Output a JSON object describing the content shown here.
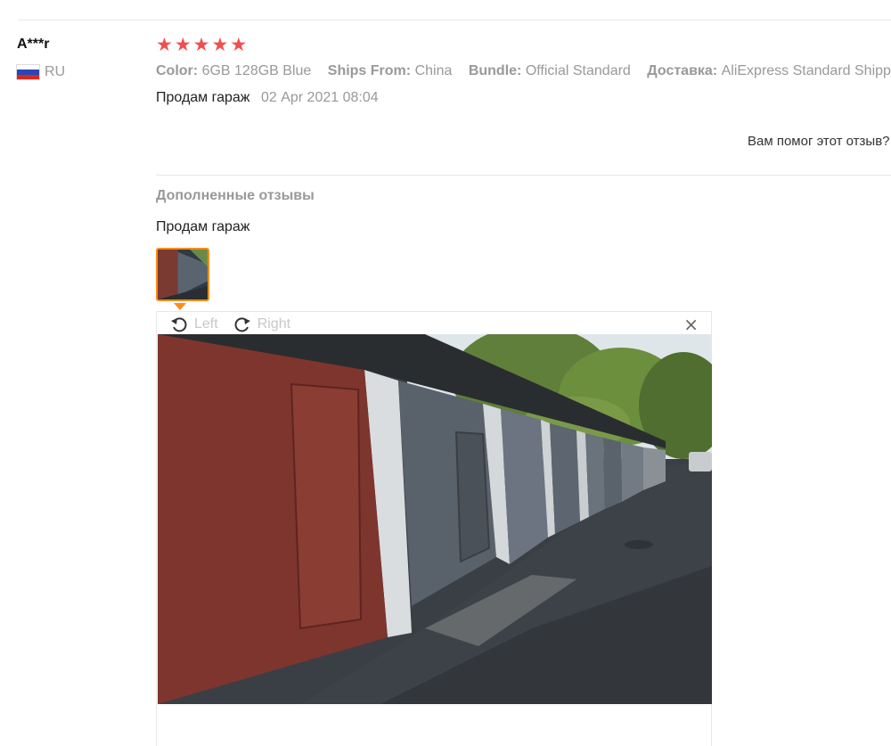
{
  "review": {
    "user_name": "A***r",
    "country": "RU",
    "stars": [
      "★",
      "★",
      "★",
      "★",
      "★"
    ],
    "rating": 5,
    "attributes": [
      {
        "key": "Color:",
        "value": "6GB 128GB Blue"
      },
      {
        "key": "Ships From:",
        "value": "China"
      },
      {
        "key": "Bundle:",
        "value": "Official Standard"
      },
      {
        "key": "Доставка:",
        "value": "AliExpress Standard Shipping"
      }
    ],
    "comment": "Продам гараж",
    "date": "02 Apr 2021 08:04",
    "helpful_text": "Вам помог этот отзыв?"
  },
  "additional": {
    "title": "Дополненные отзывы",
    "text": "Продам гараж"
  },
  "viewer": {
    "rotate_left_label": "Left",
    "rotate_right_label": "Right",
    "close_label": "×"
  },
  "colors": {
    "star": "#f04f4f",
    "accent": "#ff8c1a",
    "muted": "#999999"
  },
  "icons": {
    "rotate_left": "rotate-left-icon",
    "rotate_right": "rotate-right-icon",
    "close": "close-icon",
    "flag": "russia-flag-icon"
  }
}
